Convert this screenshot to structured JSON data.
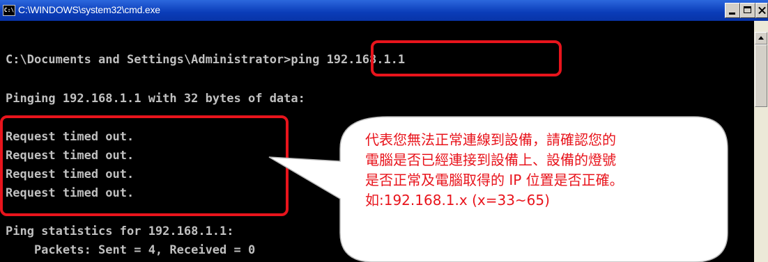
{
  "window": {
    "title": "C:\\WINDOWS\\system32\\cmd.exe",
    "icon_label": "C:\\"
  },
  "console": {
    "lines": [
      "C:\\Documents and Settings\\Administrator>ping 192.168.1.1",
      "Pinging 192.168.1.1 with 32 bytes of data:",
      "Request timed out.",
      "Request timed out.",
      "Request timed out.",
      "Request timed out.",
      "Ping statistics for 192.168.1.1:",
      "    Packets: Sent = 4, Received = 0"
    ]
  },
  "annotation": {
    "lines": [
      "代表您無法正常連線到設備，請確認您的",
      "電腦是否已經連接到設備上、設備的燈號",
      "是否正常及電腦取得的 IP 位置是否正確。",
      "如:192.168.1.x (x=33~65)"
    ],
    "color": "#e8141c"
  }
}
